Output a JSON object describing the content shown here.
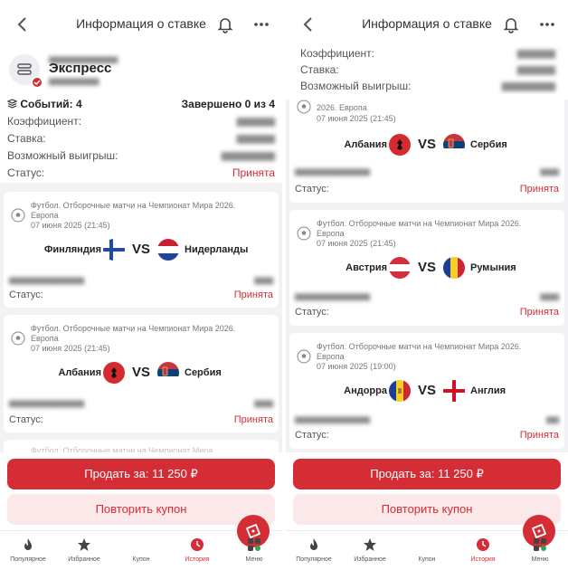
{
  "colors": {
    "accent": "#d42d36",
    "accent_soft": "#fbe9ea",
    "background": "#f2f2f4"
  },
  "header": {
    "title": "Информация о ставке"
  },
  "summary": {
    "type": "Экспресс",
    "events_label": "Событий: 4",
    "completed_label": "Завершено 0 из 4",
    "coef_label": "Коэффициент:",
    "stake_label": "Ставка:",
    "win_label": "Возможный выигрыш:",
    "status_label": "Статус:",
    "status_value": "Принята"
  },
  "events": [
    {
      "league": "Футбол. Отборочные матчи на Чемпионат Мира 2026. Европа",
      "date": "07 июня 2025 (21:45)",
      "team1": "Финляндия",
      "team2": "Нидерланды",
      "vs": "VS",
      "status_label": "Статус:",
      "status_value": "Принята"
    },
    {
      "league": "Футбол. Отборочные матчи на Чемпионат Мира 2026. Европа",
      "date": "07 июня 2025 (21:45)",
      "team1": "Албания",
      "team2": "Сербия",
      "vs": "VS",
      "status_label": "Статус:",
      "status_value": "Принята"
    },
    {
      "league": "Футбол. Отборочные матчи на Чемпионат Мира 2026. Европа",
      "date": "07 июня 2025 (21:45)",
      "team1": "Австрия",
      "team2": "Румыния",
      "vs": "VS",
      "status_label": "Статус:",
      "status_value": "Принята"
    },
    {
      "league": "Футбол. Отборочные матчи на Чемпионат Мира 2026. Европа",
      "date": "07 июня 2025 (19:00)",
      "team1": "Андорра",
      "team2": "Англия",
      "vs": "VS",
      "status_label": "Статус:",
      "status_value": "Принята"
    },
    {
      "league": "Футбол. Отборочные матчи на Чемпионат Мира"
    }
  ],
  "actions": {
    "sell": "Продать за: 11 250 ₽",
    "repeat": "Повторить купон"
  },
  "tabs": [
    {
      "label": "Популярное",
      "icon": "fire-icon"
    },
    {
      "label": "Избранное",
      "icon": "star-icon"
    },
    {
      "label": "Купон",
      "icon": "ticket-icon"
    },
    {
      "label": "История",
      "icon": "clock-icon",
      "active": true
    },
    {
      "label": "Меню",
      "icon": "grid-icon"
    }
  ]
}
